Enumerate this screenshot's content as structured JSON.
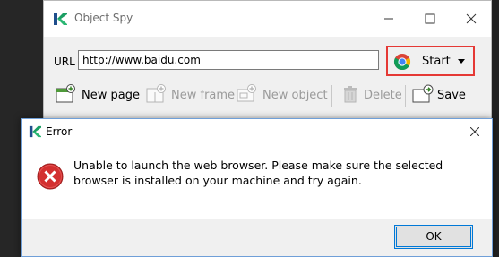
{
  "background_window": {
    "title": "Object Spy",
    "url_label": "URL",
    "url_value": "http://www.baidu.com",
    "start_button": {
      "label": "Start",
      "icon": "chrome-icon",
      "highlight_color": "#e53935"
    },
    "toolbar": {
      "new_page": "New page",
      "new_frame": "New frame",
      "new_object": "New object",
      "delete": "Delete",
      "save": "Save"
    }
  },
  "error_dialog": {
    "title": "Error",
    "message": "Unable to launch the web browser. Please make sure the selected browser is installed on your machine and try again.",
    "ok_label": "OK",
    "icon": "error-icon"
  },
  "colors": {
    "brand_green": "#1b9e63",
    "brand_dark": "#1f4e8c",
    "error_red": "#d32f2f",
    "focus_blue": "#0078d7"
  }
}
